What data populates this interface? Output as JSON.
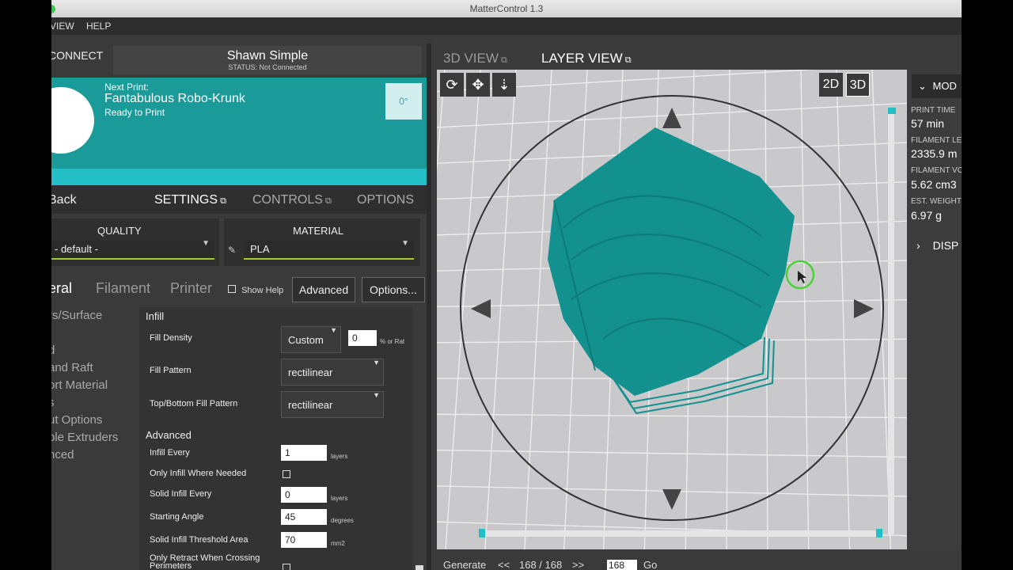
{
  "window": {
    "title": "MatterControl 1.3"
  },
  "menu": [
    "VIEW",
    "HELP"
  ],
  "connect_label": "CONNECT",
  "printer": {
    "name": "Shawn Simple",
    "status": "STATUS: Not Connected"
  },
  "next_print": {
    "label": "Next Print:",
    "name": "Fantabulous Robo-Krunk",
    "status": "Ready to Print",
    "temperature": "0°"
  },
  "tabs": {
    "back": "Back",
    "settings": "SETTINGS",
    "controls": "CONTROLS",
    "options": "OPTIONS"
  },
  "quality": {
    "label": "QUALITY",
    "value": "- default -"
  },
  "material": {
    "label": "MATERIAL",
    "value": "PLA"
  },
  "subtabs": {
    "general": "eral",
    "filament": "Filament",
    "printer": "Printer",
    "show_help": "Show Help",
    "advanced_btn": "Advanced",
    "options_btn": "Options..."
  },
  "categories": [
    "rs/Surface",
    "d",
    "and Raft",
    "ort Material",
    "s",
    "ut Options",
    "ple Extruders",
    "nced"
  ],
  "infill": {
    "title": "Infill",
    "fill_density": {
      "label": "Fill Density",
      "mode": "Custom",
      "value": "0",
      "unit": "% or Rat"
    },
    "fill_pattern": {
      "label": "Fill Pattern",
      "value": "rectilinear"
    },
    "top_bottom_pattern": {
      "label": "Top/Bottom Fill Pattern",
      "value": "rectilinear"
    }
  },
  "advanced": {
    "title": "Advanced",
    "infill_every": {
      "label": "Infill Every",
      "value": "1",
      "unit": "layers"
    },
    "only_infill_where_needed": {
      "label": "Only Infill Where Needed"
    },
    "solid_infill_every": {
      "label": "Solid Infill Every",
      "value": "0",
      "unit": "layers"
    },
    "starting_angle": {
      "label": "Starting Angle",
      "value": "45",
      "unit": "degrees"
    },
    "solid_infill_threshold": {
      "label": "Solid Infill Threshold Area",
      "value": "70",
      "unit": "mm2"
    },
    "only_retract": {
      "label": "Only Retract When Crossing Perimeters"
    }
  },
  "view_tabs": {
    "view3d": "3D VIEW",
    "layer_view": "LAYER VIEW"
  },
  "view_mode": {
    "d2": "2D",
    "d3": "3D"
  },
  "stats": {
    "mode_label": "MOD",
    "print_time_label": "PRINT TIME",
    "print_time": "57 min",
    "filament_length_label": "FILAMENT LE",
    "filament_length": "2335.9 m",
    "filament_volume_label": "FILAMENT VO",
    "filament_volume": "5.62 cm3",
    "weight_label": "EST. WEIGHT",
    "weight": "6.97 g",
    "display_label": "DISP"
  },
  "bottom": {
    "generate": "Generate",
    "prev": "<<",
    "layers": "168 / 168",
    "next": ">>",
    "layer_input": "168",
    "go": "Go"
  },
  "colors": {
    "teal": "#1b9a9a",
    "accent_bar": "#22bfc6",
    "model": "#13918f",
    "grid_bg": "#c9c9cc"
  }
}
